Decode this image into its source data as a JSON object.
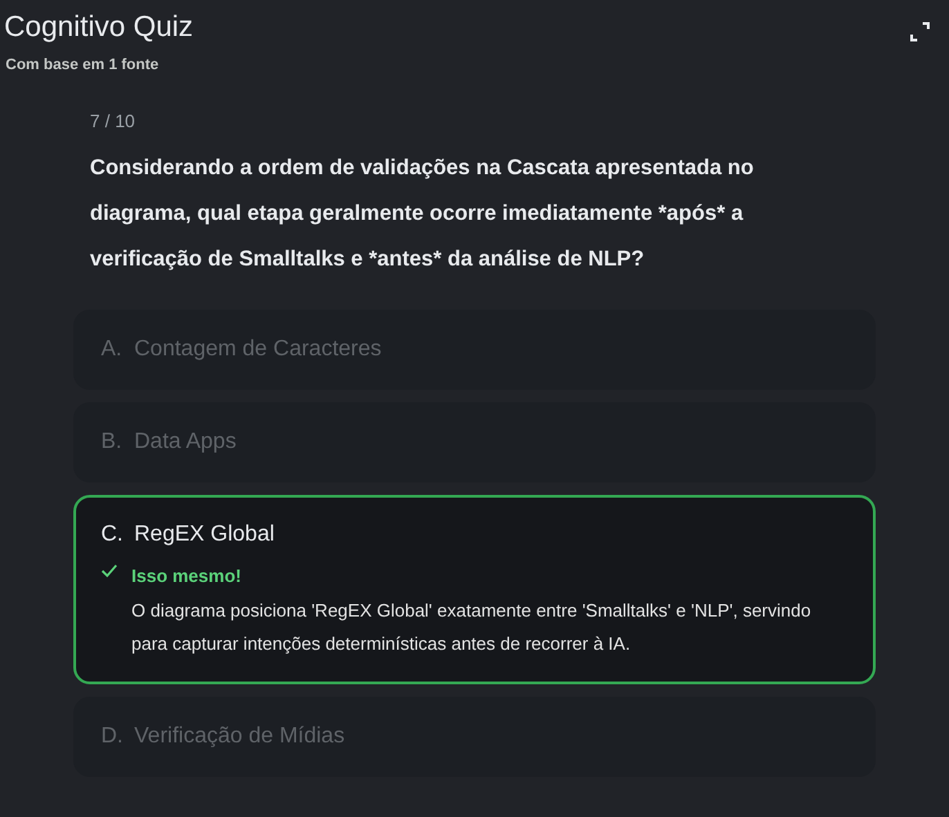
{
  "header": {
    "title": "Cognitivo Quiz",
    "subtitle": "Com base em 1 fonte"
  },
  "quiz": {
    "counter": "7 / 10",
    "question": "Considerando a ordem de validações na Cascata apresentada no diagrama, qual etapa geralmente ocorre imediatamente *após* a verificação de Smalltalks e *antes* da análise de NLP?",
    "options": [
      {
        "letter": "A.",
        "text": "Contagem de Caracteres",
        "selected": false
      },
      {
        "letter": "B.",
        "text": "Data Apps",
        "selected": false
      },
      {
        "letter": "C.",
        "text": "RegEX Global",
        "selected": true,
        "feedback": {
          "correct": true,
          "title": "Isso mesmo!",
          "explanation": "O diagrama posiciona 'RegEX Global' exatamente entre 'Smalltalks' e 'NLP', servindo para capturar intenções determinísticas antes de recorrer à IA."
        }
      },
      {
        "letter": "D.",
        "text": "Verificação de Mídias",
        "selected": false
      }
    ]
  }
}
